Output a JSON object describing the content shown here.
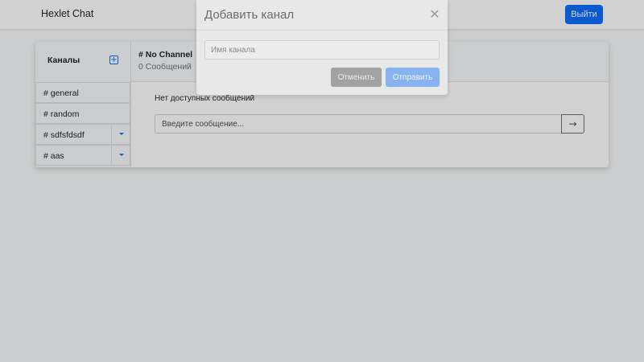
{
  "navbar": {
    "brand": "Hexlet Chat",
    "logout_label": "Выйти"
  },
  "sidebar": {
    "title": "Каналы",
    "add_icon": "plus-square-icon",
    "channels": [
      {
        "label": "# general",
        "removable": false
      },
      {
        "label": "# random",
        "removable": false
      },
      {
        "label": "# sdfsfdsdf",
        "removable": true
      },
      {
        "label": "# aas",
        "removable": true
      }
    ]
  },
  "chat": {
    "channel_title": "# No Channel",
    "message_count": "0 Сообщений",
    "empty_text": "Нет доступных сообщений",
    "input_placeholder": "Введите сообщение...",
    "send_icon": "arrow-right-icon"
  },
  "modal": {
    "title": "Добавить канал",
    "close_icon": "close-icon",
    "input_placeholder": "Имя канала",
    "input_value": "",
    "cancel_label": "Отменить",
    "submit_label": "Отправить"
  },
  "colors": {
    "primary": "#0d6efd",
    "backdrop": "rgba(0,0,0,0.18)"
  }
}
